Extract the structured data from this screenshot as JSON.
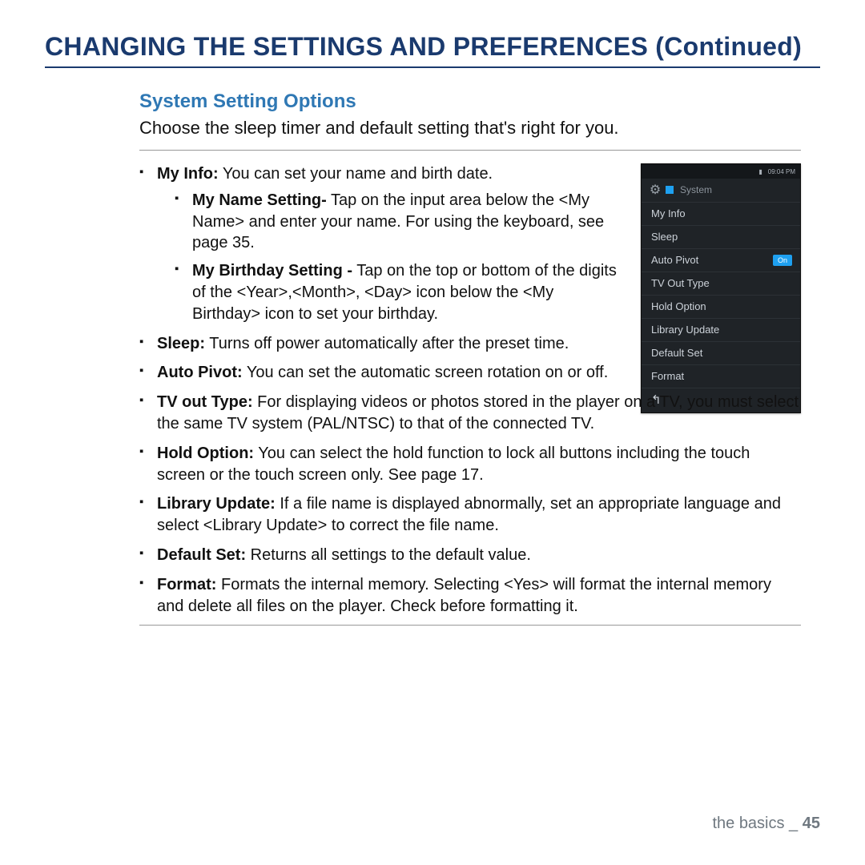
{
  "title": "CHANGING THE SETTINGS AND PREFERENCES (Continued)",
  "section_title": "System Setting Options",
  "intro": "Choose the sleep timer and default setting that's right for you.",
  "items_top": [
    {
      "label": "My Info:",
      "text": " You can set your name and birth date.",
      "sub": [
        {
          "label": "My Name Setting-",
          "text": " Tap on the input area below the <My Name> and enter your name. For using the keyboard, see page 35."
        },
        {
          "label": "My Birthday Setting -",
          "text": " Tap on the top or bottom of the digits of the <Year>,<Month>, <Day> icon below the <My Birthday> icon to set your birthday."
        }
      ]
    },
    {
      "label": "Sleep:",
      "text": " Turns off power automatically after the preset time."
    },
    {
      "label": "Auto Pivot:",
      "text": " You can set the automatic screen rotation on or off."
    }
  ],
  "items_bottom": [
    {
      "label": "TV out Type:",
      "text": " For displaying videos or photos stored in the player on a TV, you must select the same TV system (PAL/NTSC) to that of the connected TV."
    },
    {
      "label": "Hold Option:",
      "text": " You can select the hold function to lock all buttons including the touch screen or the touch screen only. See page 17."
    },
    {
      "label": "Library Update:",
      "text": " If a file name is displayed abnormally, set an appropriate language and select <Library Update> to correct the file name."
    },
    {
      "label": "Default Set:",
      "text": " Returns all settings to the default value."
    },
    {
      "label": "Format:",
      "text": " Formats the internal memory. Selecting <Yes> will format the internal memory and delete all files on the player. Check before formatting it."
    }
  ],
  "device": {
    "time": "09:04 PM",
    "header": "System",
    "rows": [
      "My Info",
      "Sleep",
      "Auto Pivot",
      "TV Out Type",
      "Hold Option",
      "Library Update",
      "Default Set",
      "Format"
    ],
    "auto_pivot_pill": "On",
    "back": "↰"
  },
  "footer_label": "the basics _ ",
  "footer_page": "45"
}
